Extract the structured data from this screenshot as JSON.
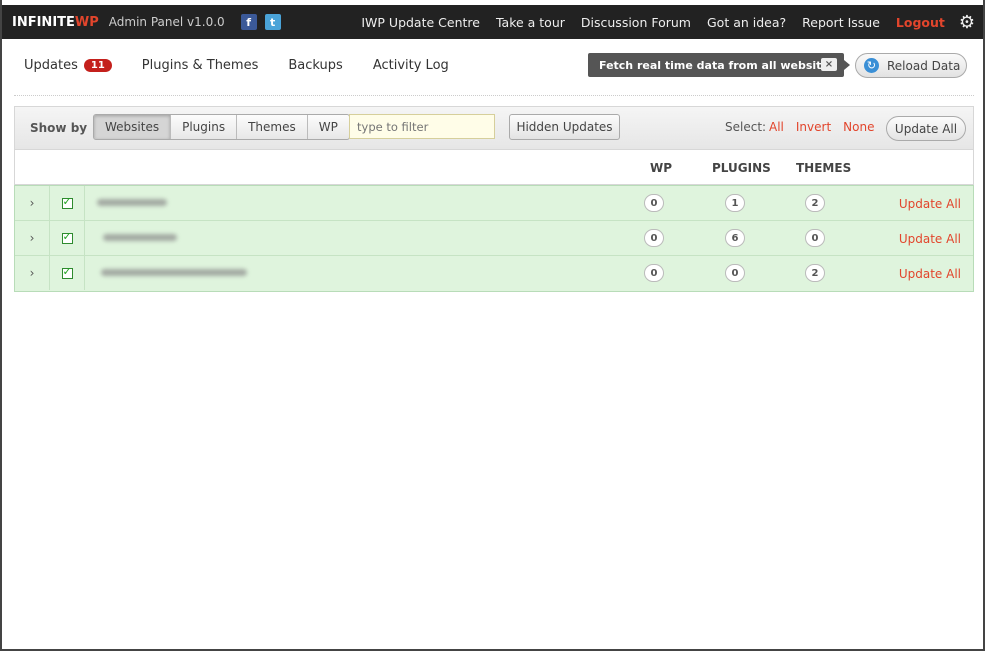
{
  "header": {
    "logo_main": "INFINITE",
    "logo_accent": "WP",
    "admin_label": "Admin Panel v1.0.0",
    "social": [
      {
        "icon": "facebook-icon",
        "glyph": "f"
      },
      {
        "icon": "twitter-icon",
        "glyph": "t"
      }
    ],
    "nav": [
      {
        "label": "IWP Update Centre"
      },
      {
        "label": "Take a tour"
      },
      {
        "label": "Discussion Forum"
      },
      {
        "label": "Got an idea?"
      },
      {
        "label": "Report Issue"
      }
    ],
    "logout": "Logout",
    "logout_color": "#e2452c"
  },
  "tabs": [
    {
      "label": "Updates",
      "badge": "11"
    },
    {
      "label": "Plugins & Themes"
    },
    {
      "label": "Backups"
    },
    {
      "label": "Activity Log"
    }
  ],
  "tooltip": {
    "text": "Fetch real time data from all websites",
    "close": "×"
  },
  "reload": {
    "label": "Reload Data"
  },
  "toolbar": {
    "show_by": "Show by",
    "views": [
      "Websites",
      "Plugins",
      "Themes",
      "WP"
    ],
    "active_view": "Websites",
    "filter_placeholder": "type to filter",
    "hidden_updates": "Hidden Updates",
    "select_label": "Select:",
    "select_all": "All",
    "select_invert": "Invert",
    "select_none": "None",
    "update_all": "Update All"
  },
  "table": {
    "columns": [
      "WP",
      "PLUGINS",
      "THEMES"
    ],
    "rows": [
      {
        "wp": "0",
        "plugins": "1",
        "themes": "2",
        "action": "Update All"
      },
      {
        "wp": "0",
        "plugins": "6",
        "themes": "0",
        "action": "Update All"
      },
      {
        "wp": "0",
        "plugins": "0",
        "themes": "2",
        "action": "Update All"
      }
    ]
  }
}
